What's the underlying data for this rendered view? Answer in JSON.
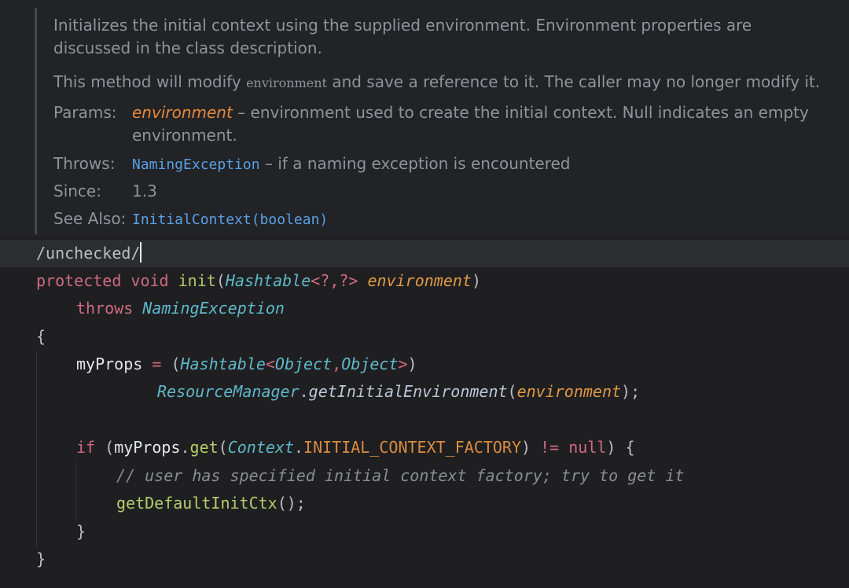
{
  "doc": {
    "description_line1": "Initializes the initial context using the supplied environment. Environment properties are",
    "description_line2": "discussed in the class description.",
    "note_before": "This method will modify ",
    "note_code": "environment",
    "note_after": " and save a reference to it. The caller may no longer modify it.",
    "params_label": "Params:",
    "param_name": "environment",
    "param_desc_line1": " – environment used to create the initial context. Null indicates an empty",
    "param_desc_line2": "environment.",
    "throws_label": "Throws:",
    "throws_link": "NamingException",
    "throws_desc": " – if a naming exception is encountered",
    "since_label": "Since:",
    "since_value": "1.3",
    "see_also_label": "See Also:",
    "see_also_link": "InitialContext(boolean)"
  },
  "code": {
    "annotation_line": "/unchecked/",
    "l1": {
      "protected": "protected",
      "void": "void",
      "init": "init",
      "paren_open": "(",
      "hashtable": "Hashtable",
      "generic": "<?,?>",
      "environment": "environment",
      "paren_close": ")"
    },
    "l2": {
      "throws": "throws",
      "exception": "NamingException"
    },
    "l3": {
      "brace": "{"
    },
    "l4": {
      "myprops": "myProps",
      "eq": "=",
      "cast_open": "(",
      "hashtable": "Hashtable",
      "lt": "<",
      "object1": "Object",
      "comma": ",",
      "object2": "Object",
      "gt": ">",
      "cast_close": ")"
    },
    "l5": {
      "resource_manager": "ResourceManager",
      "dot": ".",
      "method": "getInitialEnvironment",
      "paren_open": "(",
      "arg": "environment",
      "paren_close": ");"
    },
    "l6": {
      "if": "if",
      "open": "(",
      "myprops": "myProps",
      "dot1": ".",
      "get": "get",
      "paren_open": "(",
      "context": "Context",
      "dot2": ".",
      "constant": "INITIAL_CONTEXT_FACTORY",
      "paren_close": ")",
      "neq": "!=",
      "null": "null",
      "close": ")",
      "brace": "{"
    },
    "l7": {
      "comment": "// user has specified initial context factory; try to get it"
    },
    "l8": {
      "call": "getDefaultInitCtx",
      "parens": "();"
    },
    "l9": {
      "brace": "}"
    },
    "l10": {
      "brace": "}"
    }
  }
}
